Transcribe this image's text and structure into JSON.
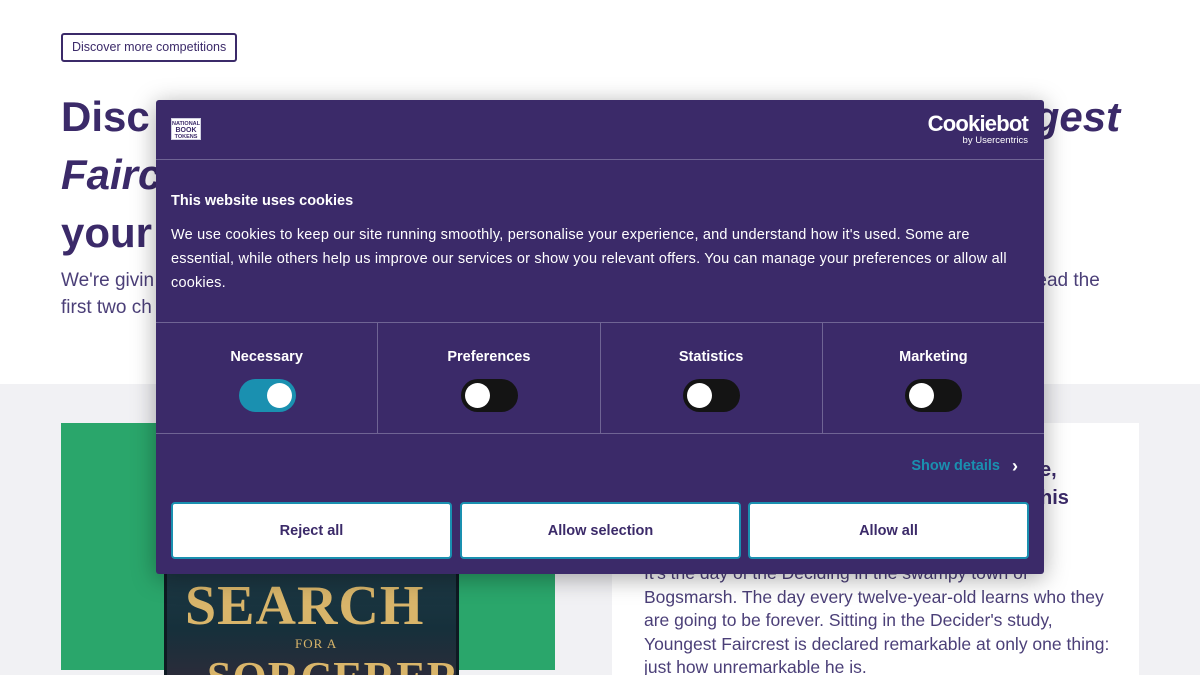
{
  "page": {
    "discover_btn": "Discover more competitions",
    "hero_line1_pre": "Disc",
    "hero_line1_post": "gest",
    "hero_line2_start": "Fairc",
    "hero_line3_start": "your",
    "sub_line1_start": "We're givin",
    "sub_line1_end": "read the",
    "sub_line2_start": "first two ch",
    "info_title_line1": "e,",
    "info_title_line2": "his",
    "info_text_line1": "It's the day of the Deciding in the swampy town of",
    "info_text_rest": "Bogsmarsh. The day every twelve-year-old learns who they are going to be forever. Sitting in the Decider's study, Youngest Faircrest is declared remarkable at only one thing: just how unremarkable he is.",
    "book_word1": "SEARCH",
    "book_word2": "FOR A",
    "book_word3": "SORCERER"
  },
  "cookie": {
    "brand_logo_line1": "NATIONAL",
    "brand_logo_line2": "BOOK",
    "brand_logo_line3": "TOKENS",
    "cookiebot_word": "Cookiebot",
    "cookiebot_sub": "by Usercentrics",
    "heading": "This website uses cookies",
    "text": "We use cookies to keep our site running smoothly, personalise your experience, and understand how it's used. Some are essential, while others help us improve our services or show you relevant offers. You can manage your preferences or allow all cookies.",
    "toggles": [
      {
        "label": "Necessary",
        "on": true
      },
      {
        "label": "Preferences",
        "on": false
      },
      {
        "label": "Statistics",
        "on": false
      },
      {
        "label": "Marketing",
        "on": false
      }
    ],
    "show_details": "Show details",
    "buttons": {
      "reject": "Reject all",
      "selection": "Allow selection",
      "allow": "Allow all"
    }
  },
  "colors": {
    "brand_purple": "#3b2a69",
    "accent_teal": "#1a90b0",
    "green_panel": "#2aa66b"
  }
}
